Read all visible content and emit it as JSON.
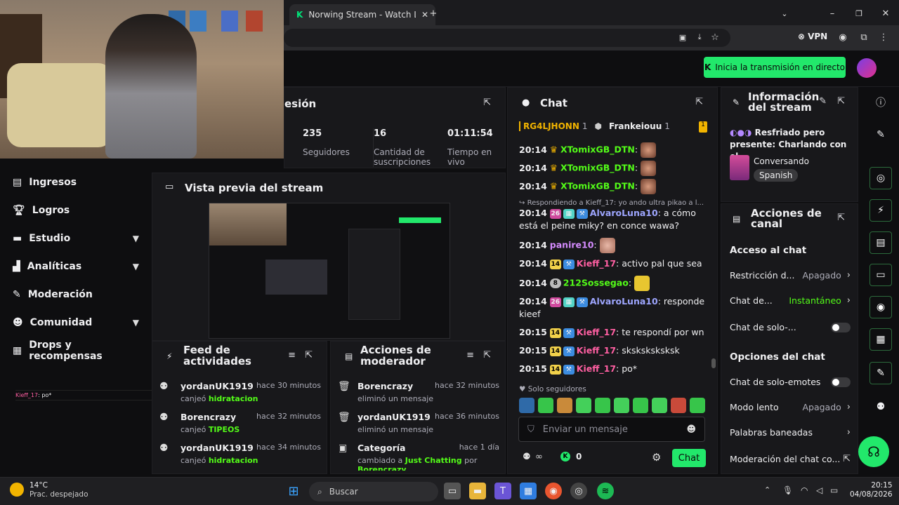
{
  "browser": {
    "tab_title": "Norwing Stream - Watch Live o",
    "vpn_label": "VPN"
  },
  "app": {
    "go_live_label": "Inicia la transmisión en directo"
  },
  "nav": {
    "items": [
      {
        "label": "Ingresos",
        "icon": "money-icon"
      },
      {
        "label": "Logros",
        "icon": "trophy-icon"
      },
      {
        "label": "Estudio",
        "icon": "studio-icon"
      },
      {
        "label": "Analíticas",
        "icon": "analytics-icon"
      },
      {
        "label": "Moderación",
        "icon": "wrench-icon"
      },
      {
        "label": "Comunidad",
        "icon": "community-icon"
      },
      {
        "label": "Drops y recompensas",
        "icon": "gift-icon"
      }
    ],
    "mini_chat_user": "Kieff_17",
    "mini_chat_msg": ": po*"
  },
  "session": {
    "title": "esión",
    "stats": [
      {
        "value": "235",
        "label": "Seguidores"
      },
      {
        "value": "16",
        "label": "Cantidad de suscripciones"
      },
      {
        "value": "01:11:54",
        "label": "Tiempo en vivo"
      }
    ]
  },
  "preview": {
    "title": "Vista previa del stream"
  },
  "feed": {
    "title": "Feed de actividades",
    "rows": [
      {
        "user": "yordanUK1919",
        "time": "hace 30 minutos",
        "action": "canjeó",
        "item": "hidratacion"
      },
      {
        "user": "Borencrazy",
        "time": "hace 32 minutos",
        "action": "canjeó",
        "item": "TIPEOS"
      },
      {
        "user": "yordanUK1919",
        "time": "hace 34 minutos",
        "action": "canjeó",
        "item": "hidratacion"
      }
    ]
  },
  "modactions": {
    "title": "Acciones de moderador",
    "rows": [
      {
        "user": "Borencrazy",
        "time": "hace 32 minutos",
        "desc": "eliminó un mensaje"
      },
      {
        "user": "yordanUK1919",
        "time": "hace 36 minutos",
        "desc": "eliminó un mensaje"
      },
      {
        "user": "Categoría",
        "time": "hace 1 día",
        "desc": "cambiado a",
        "item": "Just Chatting",
        "suffix": "por",
        "by": "Borencrazy"
      }
    ]
  },
  "chat": {
    "title": "Chat",
    "pinned": [
      {
        "name": "RG4LJHONN",
        "count": "1"
      },
      {
        "name": "Frankeiouu",
        "count": "1"
      }
    ],
    "reply_note": "Respondiendo a Kieff_17: yo ando ultra pikao a l...",
    "messages": [
      {
        "ts": "20:14",
        "badge": "",
        "user": "XTomixGB_DTN",
        "text": "",
        "color": "#53fc18"
      },
      {
        "ts": "20:14",
        "badge": "",
        "user": "XTomixGB_DTN",
        "text": "",
        "color": "#53fc18"
      },
      {
        "ts": "20:14",
        "badge": "",
        "user": "XTomixGB_DTN",
        "text": "",
        "color": "#53fc18"
      },
      {
        "ts": "20:14",
        "badge": "26",
        "user": "AlvaroLuna10",
        "text": ": a cómo está el peine miky? en conce wawa?",
        "color": "#9ea6ff"
      },
      {
        "ts": "20:14",
        "badge": "",
        "user": "panire10",
        "text": "",
        "color": "#d58cff"
      },
      {
        "ts": "20:14",
        "badge": "14",
        "user": "Kieff_17",
        "text": ": activo pal que sea",
        "color": "#ff5fa2"
      },
      {
        "ts": "20:14",
        "badge": "8",
        "user": "212Sossegao",
        "text": "",
        "color": "#53fc18"
      },
      {
        "ts": "20:14",
        "badge": "26",
        "user": "AlvaroLuna10",
        "text": ": responde kieef",
        "color": "#9ea6ff"
      },
      {
        "ts": "20:15",
        "badge": "14",
        "user": "Kieff_17",
        "text": ": te respondí por wn",
        "color": "#ff5fa2"
      },
      {
        "ts": "20:15",
        "badge": "14",
        "user": "Kieff_17",
        "text": ": sksksksksksk",
        "color": "#ff5fa2"
      },
      {
        "ts": "20:15",
        "badge": "14",
        "user": "Kieff_17",
        "text": ": po*",
        "color": "#ff5fa2"
      }
    ],
    "followers_only": "Solo seguidores",
    "input_placeholder": "Enviar un mensaje",
    "kick_count": "0",
    "send_label": "Chat"
  },
  "info": {
    "title": "Información del stream",
    "stream_title": "Resfriado pero presente: Charlando con el...",
    "category": "Conversando",
    "language": "Spanish"
  },
  "channel": {
    "title": "Acciones de canal",
    "section1": "Acceso al chat",
    "rows1": [
      {
        "label": "Restricción d...",
        "value": "Apagado"
      },
      {
        "label": "Chat de...",
        "value": "Instantáneo"
      },
      {
        "label": "Chat de solo-...",
        "value": ""
      }
    ],
    "section2": "Opciones del chat",
    "rows2": [
      {
        "label": "Chat de solo-emotes",
        "value": ""
      },
      {
        "label": "Modo lento",
        "value": "Apagado"
      },
      {
        "label": "Palabras baneadas",
        "value": ""
      },
      {
        "label": "Moderación del chat co...",
        "value": ""
      }
    ]
  },
  "taskbar": {
    "temp": "14°C",
    "weather": "Prac. despejado",
    "search": "Buscar",
    "time": "20:15",
    "date": "04/08/2026"
  },
  "colors": {
    "accent": "#22e86b",
    "bg": "#0e0e10",
    "panel": "#18181b"
  }
}
